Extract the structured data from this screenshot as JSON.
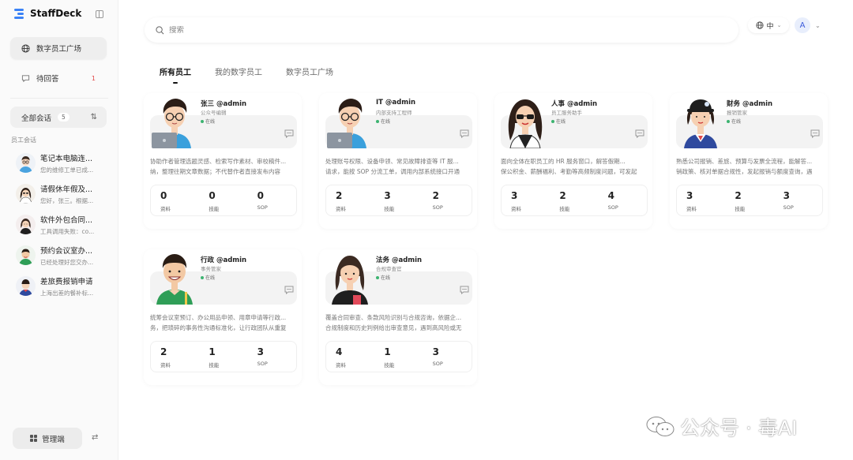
{
  "brand": {
    "name": "StaffDeck"
  },
  "sidebar": {
    "nav": [
      {
        "label": "数字员工广场",
        "active": true
      },
      {
        "label": "待回答",
        "badge": "1"
      }
    ],
    "conversation_filter": {
      "label": "全部会话",
      "count": "5"
    },
    "section_label": "员工会话",
    "conversations": [
      {
        "title": "笔记本电脑连...",
        "snippet": "您的维修工单已成..."
      },
      {
        "title": "请假休年假及...",
        "snippet": "您好，张三。根据..."
      },
      {
        "title": "软件外包合同...",
        "snippet": "工具调用失败：co..."
      },
      {
        "title": "预约会议室办...",
        "snippet": "已经处理好您交办..."
      },
      {
        "title": "差旅费报销申请",
        "snippet": "上海出差的餐补标..."
      }
    ],
    "admin_label": "管理端"
  },
  "header": {
    "search_placeholder": "搜索",
    "language": "中",
    "user_initial": "A"
  },
  "tabs": [
    "所有员工",
    "我的数字员工",
    "数字员工广场"
  ],
  "employees": [
    {
      "name": "张三 @admin",
      "role": "公众号编辑",
      "status": "在线",
      "desc1": "协助作者管理选题灵感、检索写作素材、审校稿件...",
      "desc2": "纳，整理往期文章数据；不代替作者直接发布内容",
      "stats": [
        "0",
        "0",
        "0"
      ]
    },
    {
      "name": "IT @admin",
      "role": "内部支持工程师",
      "status": "在线",
      "desc1": "处理账号权限、设备申领、常见故障排查等 IT 服...",
      "desc2": "请求，能按 SOP 分流工单，调用内部系统接口开通",
      "stats": [
        "2",
        "3",
        "2"
      ]
    },
    {
      "name": "人事 @admin",
      "role": "员工服务助手",
      "status": "在线",
      "desc1": "面向全体在职员工的 HR 服务窗口，解答假期...",
      "desc2": "保公积金、薪酬福利、考勤等高频制度问题，可发起",
      "stats": [
        "3",
        "2",
        "4"
      ]
    },
    {
      "name": "财务 @admin",
      "role": "报销管家",
      "status": "在线",
      "desc1": "熟悉公司报销、差旅、预算与发票全流程，能解答...",
      "desc2": "销政策、核对单据合规性，发起报销与额度查询，遇",
      "stats": [
        "3",
        "2",
        "3"
      ]
    },
    {
      "name": "行政 @admin",
      "role": "事务管家",
      "status": "在线",
      "desc1": "统筹会议室预订、办公用品申领、用章申请等行政...",
      "desc2": "务，把琐碎的事务性沟通标准化，让行政团队从重复",
      "stats": [
        "2",
        "1",
        "3"
      ]
    },
    {
      "name": "法务 @admin",
      "role": "合规审查官",
      "status": "在线",
      "desc1": "覆盖合同审查、条款风险识别与合规咨询，依据企...",
      "desc2": "合规制度和历史判例给出审查意见，遇到高风险或无",
      "stats": [
        "4",
        "1",
        "3"
      ]
    }
  ],
  "stat_labels": [
    "资料",
    "技能",
    "SOP"
  ],
  "watermark": {
    "text": "公众号 · 毒AI"
  }
}
